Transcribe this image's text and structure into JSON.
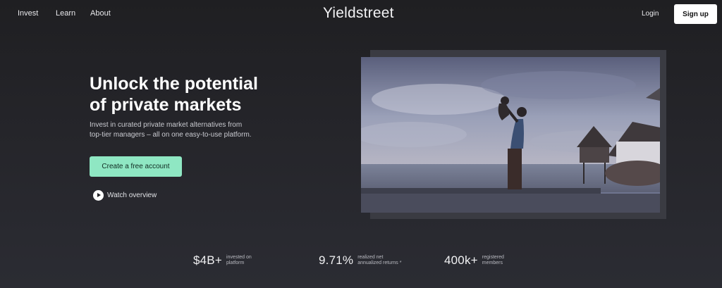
{
  "nav": {
    "items": [
      "Invest",
      "Learn",
      "About"
    ],
    "logo": "Yieldstreet",
    "login": "Login",
    "signup": "Sign up"
  },
  "hero": {
    "title_line1": "Unlock the potential",
    "title_line2": "of private markets",
    "subtitle_line1": "Invest in curated private market alternatives from",
    "subtitle_line2": "top-tier managers – all on one easy-to-use platform.",
    "cta": "Create a free account",
    "watch": "Watch overview"
  },
  "stats": [
    {
      "value": "$4B+",
      "label_line1": "invested on",
      "label_line2": "platform"
    },
    {
      "value": "9.71%",
      "label_line1": "realized net",
      "label_line2": "annualized returns *"
    },
    {
      "value": "400k+",
      "label_line1": "registered",
      "label_line2": "members"
    }
  ],
  "colors": {
    "accent": "#8fe7c3",
    "background": "#25252a",
    "signup_bg": "#ffffff"
  },
  "icons": {
    "play": "play-circle-icon"
  }
}
